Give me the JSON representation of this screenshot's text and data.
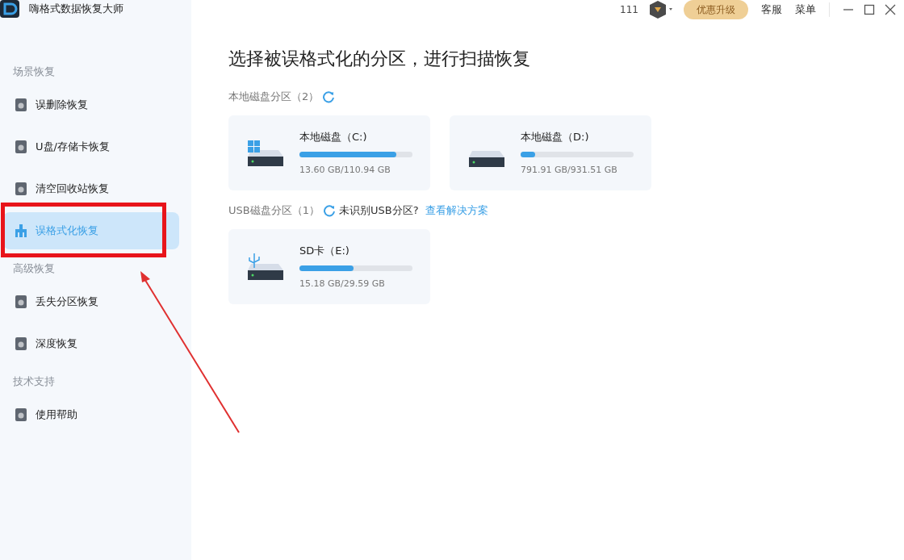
{
  "app": {
    "title": "嗨格式数据恢复大师"
  },
  "header": {
    "count": "111",
    "upgrade": "优惠升级",
    "links": [
      "客服",
      "菜单"
    ]
  },
  "sidebar": {
    "sections": [
      {
        "title": "场景恢复",
        "items": [
          {
            "label": "误删除恢复",
            "selected": false
          },
          {
            "label": "U盘/存储卡恢复",
            "selected": false
          },
          {
            "label": "清空回收站恢复",
            "selected": false
          },
          {
            "label": "误格式化恢复",
            "selected": true
          }
        ]
      },
      {
        "title": "高级恢复",
        "items": [
          {
            "label": "丢失分区恢复",
            "selected": false
          },
          {
            "label": "深度恢复",
            "selected": false
          }
        ]
      },
      {
        "title": "技术支持",
        "items": [
          {
            "label": "使用帮助",
            "selected": false
          }
        ]
      }
    ]
  },
  "main": {
    "title": "选择被误格式化的分区，进行扫描恢复",
    "groups": [
      {
        "label": "本地磁盘分区（2）",
        "drives": [
          {
            "kind": "system",
            "name": "本地磁盘（C:)",
            "level": 0.86,
            "usage": "13.60 GB/110.94 GB"
          },
          {
            "kind": "plain",
            "name": "本地磁盘（D:)",
            "level": 0.13,
            "usage": "791.91 GB/931.51 GB"
          }
        ]
      },
      {
        "label": "USB磁盘分区（1）",
        "hint": "未识别USB分区?",
        "link": "查看解决方案",
        "drives": [
          {
            "kind": "usb",
            "name": "SD卡（E:)",
            "level": 0.48,
            "usage": "15.18 GB/29.59 GB"
          }
        ]
      }
    ]
  }
}
